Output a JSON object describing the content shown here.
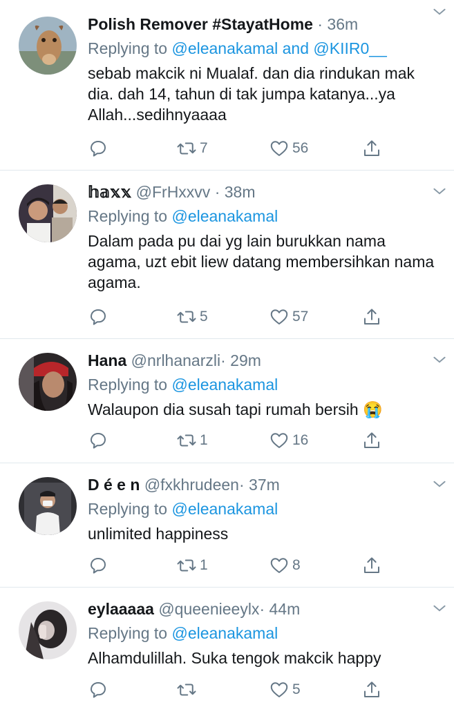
{
  "colors": {
    "accent": "#1b95e0",
    "muted": "#657786",
    "text": "#14171a",
    "divider": "#e1e8ed"
  },
  "icons": {
    "reply": "reply-icon",
    "retweet": "retweet-icon",
    "like": "heart-icon",
    "share": "share-icon",
    "menu": "chevron-down-icon"
  },
  "tweets": [
    {
      "name": "Polish Remover #StayatHome",
      "handle": "",
      "sep": "·",
      "time": "36m",
      "replying_prefix": "Replying to",
      "replying_to": "@eleanakamal and @KIIR0__",
      "text": "sebab makcik ni Mualaf. dan dia rindukan mak dia. dah 14, tahun di tak jumpa katanya...ya Allah...sedihnyaaaa",
      "retweets": "7",
      "likes": "56"
    },
    {
      "name": "𝕙𝕒𝕩𝕩",
      "handle": "@FrHxxvv",
      "sep": "·",
      "time": "38m",
      "replying_prefix": "Replying to",
      "replying_to": "@eleanakamal",
      "text": "Dalam pada pu dai yg lain burukkan nama agama, uzt ebit liew datang membersihkan nama agama.",
      "retweets": "5",
      "likes": "57"
    },
    {
      "name": "Hana",
      "handle": "@nrlhanarzli",
      "sep": "·",
      "time": "29m",
      "replying_prefix": "Replying to",
      "replying_to": "@eleanakamal",
      "text": "Walaupon dia susah tapi rumah bersih 😭",
      "retweets": "1",
      "likes": "16"
    },
    {
      "name": "D é e n",
      "handle": "@fxkhrudeen",
      "sep": "·",
      "time": "37m",
      "replying_prefix": "Replying to",
      "replying_to": "@eleanakamal",
      "text": "unlimited happiness",
      "retweets": "1",
      "likes": "8"
    },
    {
      "name": "eylaaaaa",
      "handle": "@queenieeylx",
      "sep": "·",
      "time": "44m",
      "replying_prefix": "Replying to",
      "replying_to": "@eleanakamal",
      "text": "Alhamdulillah. Suka tengok makcik happy",
      "retweets": "",
      "likes": "5"
    }
  ]
}
